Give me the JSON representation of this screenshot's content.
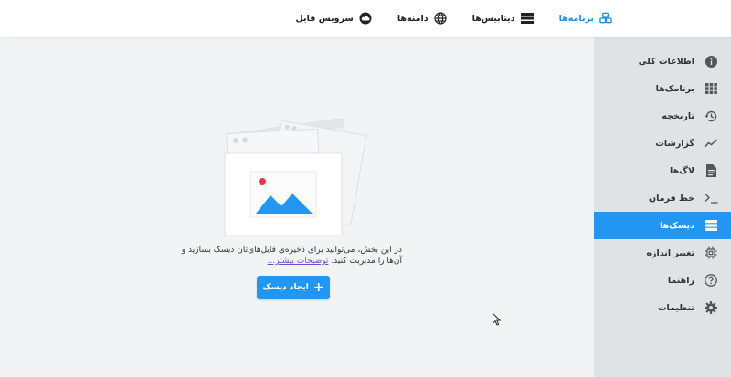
{
  "topnav": {
    "items": [
      {
        "label": "برنامه‌ها",
        "icon": "apps-cubes-icon",
        "active": true
      },
      {
        "label": "دیتابیس‌ها",
        "icon": "database-list-icon",
        "active": false
      },
      {
        "label": "دامنه‌ها",
        "icon": "globe-icon",
        "active": false
      },
      {
        "label": "سرویس فایل",
        "icon": "cloud-icon",
        "active": false
      }
    ]
  },
  "sidebar": {
    "items": [
      {
        "label": "اطلاعات کلی",
        "icon": "info-icon"
      },
      {
        "label": "برنامک‌ها",
        "icon": "grid-icon"
      },
      {
        "label": "تاریخچه",
        "icon": "history-icon"
      },
      {
        "label": "گزارشات",
        "icon": "trend-chart-icon"
      },
      {
        "label": "لاگ‌ها",
        "icon": "document-icon"
      },
      {
        "label": "خط فرمان",
        "icon": "terminal-icon"
      },
      {
        "label": "دیسک‌ها",
        "icon": "disks-icon",
        "active": true
      },
      {
        "label": "تغییر اندازه",
        "icon": "cpu-icon"
      },
      {
        "label": "راهنما",
        "icon": "help-icon"
      },
      {
        "label": "تنظیمات",
        "icon": "settings-gear-icon"
      }
    ]
  },
  "empty_state": {
    "text": "در این بخش، می‌توانید برای ذخیره‌ی فایل‌های‌تان دیسک بسازید و آن‌ها را مدیریت کنید.",
    "link": "توضیحات بیشتر...",
    "button_label": "ایجاد دیسک"
  },
  "colors": {
    "accent": "#2196f3",
    "sidebar_bg": "#dfe3e6",
    "main_bg": "#f2f3f5",
    "link": "#6d4bd1"
  }
}
